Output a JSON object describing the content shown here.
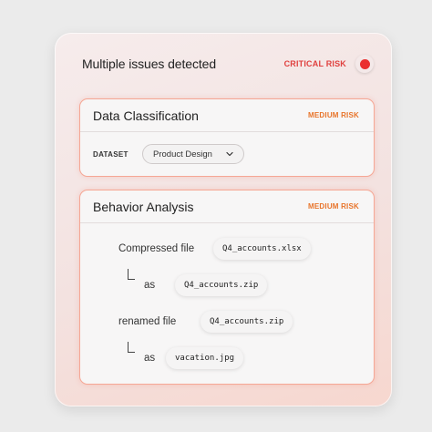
{
  "header": {
    "title": "Multiple issues detected",
    "risk_label": "CRITICAL RISK",
    "status_color": "#ea2f2f"
  },
  "classification": {
    "title": "Data Classification",
    "risk_label": "MEDIUM RISK",
    "dataset_label": "DATASET",
    "dataset_value": "Product Design"
  },
  "behavior": {
    "title": "Behavior Analysis",
    "risk_label": "MEDIUM RISK",
    "steps": [
      {
        "label": "Compressed file",
        "value": "Q4_accounts.xlsx"
      },
      {
        "label": "as",
        "value": "Q4_accounts.zip"
      },
      {
        "label": "renamed file",
        "value": "Q4_accounts.zip"
      },
      {
        "label": "as",
        "value": "vacation.jpg"
      }
    ]
  },
  "colors": {
    "critical": "#e0413f",
    "medium": "#e8742a",
    "card_border": "#f5a795"
  }
}
